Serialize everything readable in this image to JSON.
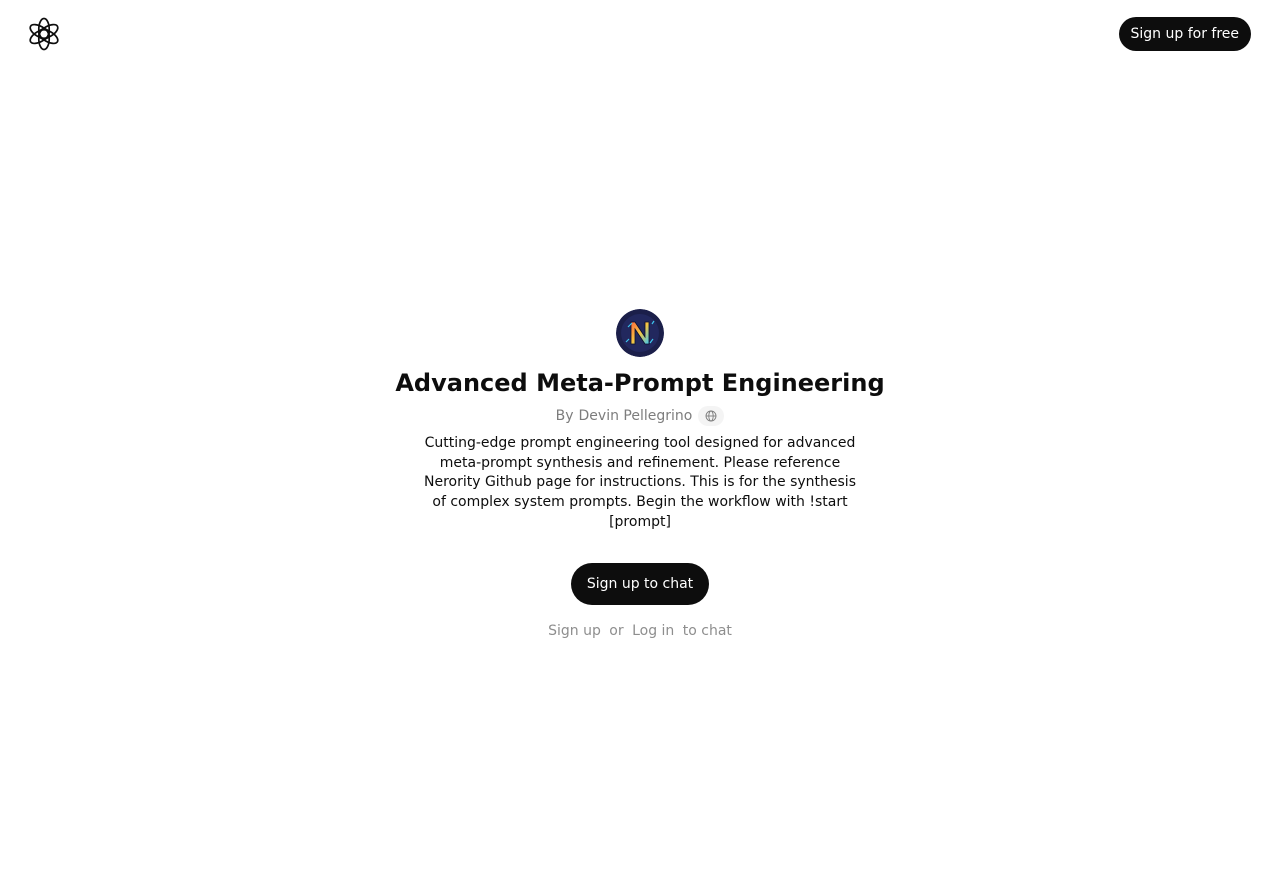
{
  "header": {
    "logo_icon": "openai-logo-icon",
    "signup_label": "Sign up for free"
  },
  "gpt": {
    "avatar_icon": "neon-n-logo-avatar",
    "title": "Advanced Meta-Prompt Engineering",
    "by_prefix": "By",
    "author": "Devin Pellegrino",
    "website_icon": "globe-icon",
    "description": "Cutting-edge prompt engineering tool designed for advanced meta-prompt synthesis and refinement. Please reference Nerority Github page for instructions. This is for the synthesis of complex system prompts. Begin the workflow with !start [prompt]"
  },
  "cta": {
    "chat_label": "Sign up to chat",
    "signup_link": "Sign up",
    "or_text": "or",
    "login_link": "Log in",
    "to_chat_text": "to chat"
  },
  "colors": {
    "button_bg": "#0d0d0d",
    "button_text": "#ffffff",
    "muted_text": "#7d7d7d",
    "avatar_bg": "#1b1f4a"
  }
}
